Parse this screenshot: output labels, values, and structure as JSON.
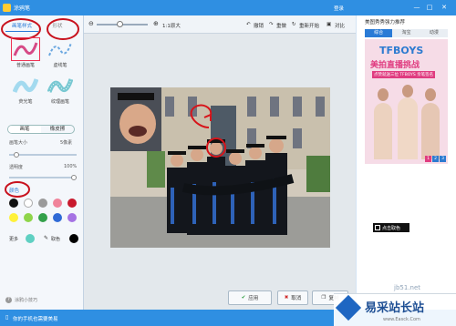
{
  "window": {
    "title": "涂鸦笔",
    "login": "登录",
    "min": "—",
    "max": "□",
    "close": "✕"
  },
  "left": {
    "tabs": [
      "画笔样式",
      "形状"
    ],
    "brushes": [
      {
        "label": "普通画笔",
        "color": "#d64a86"
      },
      {
        "label": "虚线笔",
        "color": "#6aa7e0"
      },
      {
        "label": "荧光笔",
        "color": "#8ed2ec"
      },
      {
        "label": "纹理画笔",
        "color": "#78c8d2"
      }
    ],
    "modes": [
      "画笔",
      "橡皮擦"
    ],
    "size_label": "画笔大小",
    "size_value": "5像素",
    "size_level": 0.08,
    "opacity_label": "透明度",
    "opacity_value": "100%",
    "opacity_level": 1.0,
    "colors_title": "颜色",
    "palette": [
      "#111111",
      "#ffffff",
      "#9a9a9a",
      "#f0839a",
      "#c8192d",
      "#fff13a",
      "#8fd54a",
      "#33a04a",
      "#2f6ad6",
      "#a572e3"
    ],
    "more_label": "更多",
    "picker_label": "取色",
    "current_color": "#000000",
    "tip": "涂鸦小技巧"
  },
  "toolbar": {
    "zoom_label": "1:1原大",
    "undo": "撤销",
    "redo": "重做",
    "reset": "重新开始",
    "compare": "对比"
  },
  "actions": {
    "apply": "应用",
    "cancel": "取消",
    "reset": "复制"
  },
  "right": {
    "title": "美图秀秀强力推荐",
    "tabs": [
      "综合",
      "淘宝",
      "动漫"
    ],
    "ad_line1": "TFBOYS",
    "ad_line2": "美拍直播挑战",
    "ad_line3": "点赞就送三位 TFBOYS 亲笔签名",
    "pages": [
      "1",
      "2",
      "3"
    ]
  },
  "tooltip": "点击取色",
  "status": "你的手机也需要美易",
  "watermark": {
    "site": "易采站长站",
    "url": "www.Easck.Com",
    "small": "jb51.net"
  }
}
